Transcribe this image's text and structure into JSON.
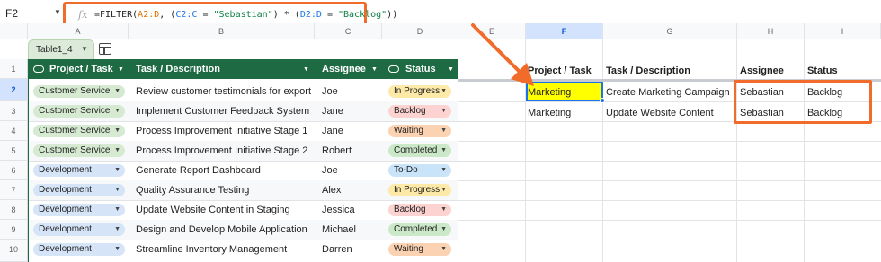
{
  "name_box": "F2",
  "formula": {
    "fn": "=FILTER(",
    "ref1": "A2:D",
    "p1": ", (",
    "ref2": "C2:C",
    "p2": " = ",
    "str1": "\"Sebastian\"",
    "p3": ") * (",
    "ref3": "D2:D",
    "p4": " = ",
    "str2": "\"Backlog\"",
    "p5": "))"
  },
  "columns": [
    "A",
    "B",
    "C",
    "D",
    "E",
    "F",
    "G",
    "H",
    "I"
  ],
  "rows": [
    "1",
    "2",
    "3",
    "4",
    "5",
    "6",
    "7",
    "8",
    "9",
    "10"
  ],
  "table": {
    "name": "Table1_4",
    "headers": [
      "Project / Task",
      "Task / Description",
      "Assignee",
      "Status"
    ],
    "rows": [
      {
        "project": "Customer Service",
        "task": "Review customer testimonials for export",
        "assignee": "Joe",
        "status": "In Progress"
      },
      {
        "project": "Customer Service",
        "task": "Implement Customer Feedback System",
        "assignee": "Jane",
        "status": "Backlog"
      },
      {
        "project": "Customer Service",
        "task": "Process Improvement Initiative Stage 1",
        "assignee": "Jane",
        "status": "Waiting"
      },
      {
        "project": "Customer Service",
        "task": "Process Improvement Initiative Stage 2",
        "assignee": "Robert",
        "status": "Completed"
      },
      {
        "project": "Development",
        "task": "Generate Report Dashboard",
        "assignee": "Joe",
        "status": "To-Do"
      },
      {
        "project": "Development",
        "task": "Quality Assurance Testing",
        "assignee": "Alex",
        "status": "In Progress"
      },
      {
        "project": "Development",
        "task": "Update Website Content in Staging",
        "assignee": "Jessica",
        "status": "Backlog"
      },
      {
        "project": "Development",
        "task": "Design and Develop Mobile Application",
        "assignee": "Michael",
        "status": "Completed"
      },
      {
        "project": "Development",
        "task": "Streamline Inventory Management",
        "assignee": "Darren",
        "status": "Waiting"
      }
    ]
  },
  "colors": {
    "table_header": "#1e6b43",
    "customer_service_chip": "#d6ead2",
    "development_chip": "#d5e4f7",
    "in_progress": "#fde9a8",
    "backlog": "#fcd3d1",
    "waiting": "#fbd3b3",
    "completed": "#cbe8c8",
    "todo": "#c9e3f8",
    "highlight": "#f16b2a",
    "selected_fill": "#ffff00"
  },
  "result": {
    "headers": [
      "Project / Task",
      "Task / Description",
      "Assignee",
      "Status"
    ],
    "rows": [
      [
        "Marketing",
        "Create Marketing Campaign",
        "Sebastian",
        "Backlog"
      ],
      [
        "Marketing",
        "Update Website Content",
        "Sebastian",
        "Backlog"
      ]
    ]
  },
  "icons": [
    "fx-icon",
    "dropdown-icon",
    "table-grid-icon",
    "chip-column-icon",
    "sort-arrow-icon",
    "annotation-arrow"
  ]
}
